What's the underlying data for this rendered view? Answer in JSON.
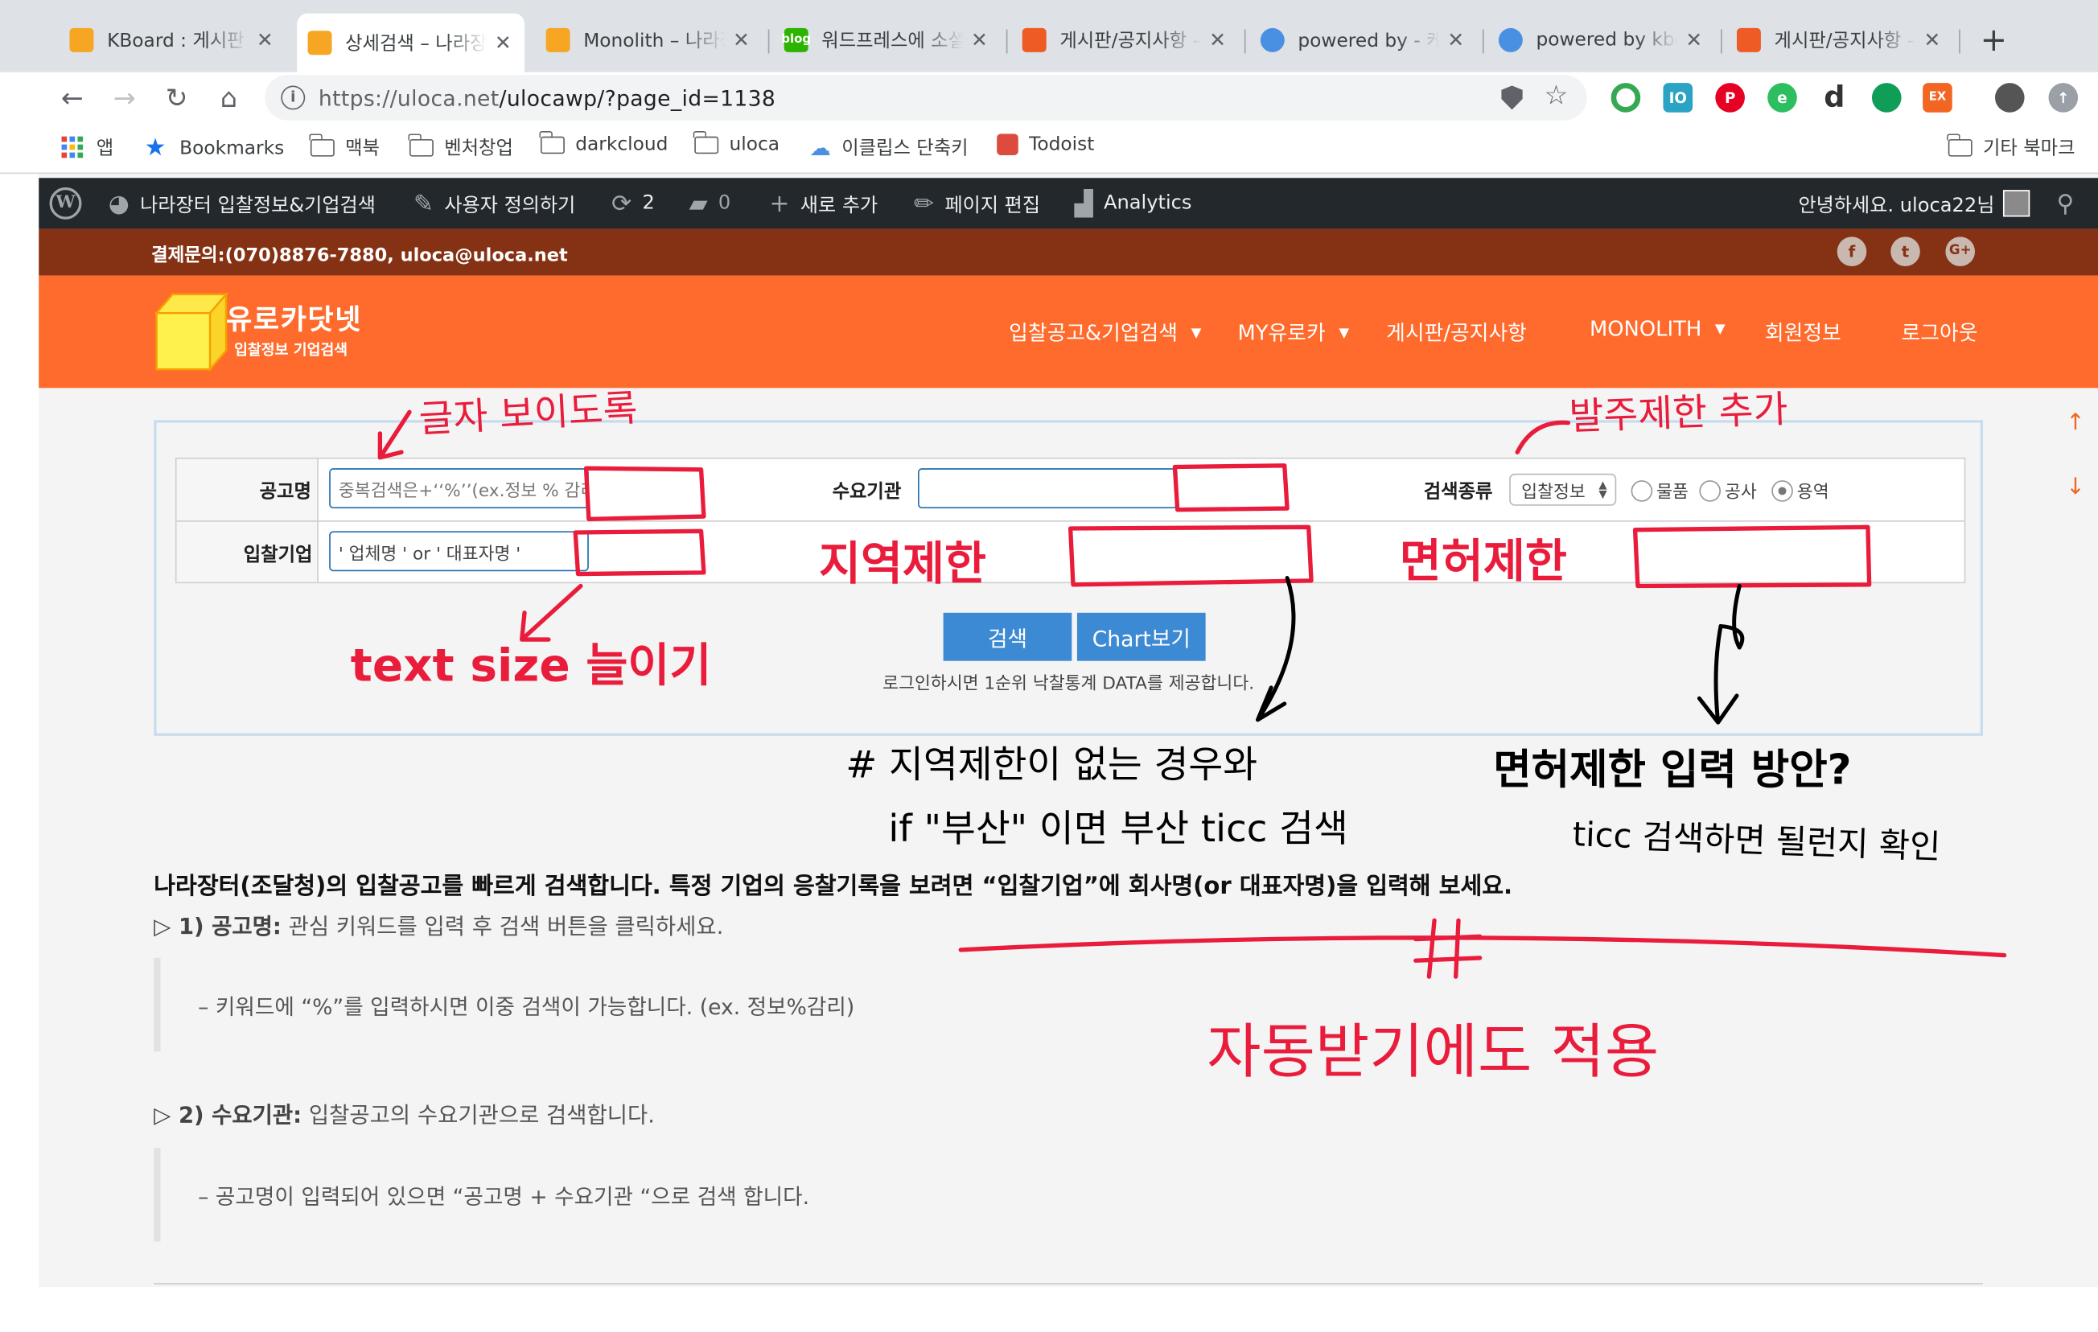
{
  "browser": {
    "tabs": [
      {
        "title": "KBoard : 게시판 플러그인",
        "favicon_color": "#f6a623"
      },
      {
        "title": "상세검색 – 나라장터",
        "favicon_color": "#f6a623"
      },
      {
        "title": "Monolith – 나라장터",
        "favicon_color": "#f6a623"
      },
      {
        "title": "워드프레스에 소셜",
        "favicon_color": "#2db400",
        "favicon_text": "blog"
      },
      {
        "title": "게시판/공지사항 – 유로카",
        "favicon_color": "#ef5b25"
      },
      {
        "title": "powered by - 케이보드",
        "favicon_color": "#4a90e2"
      },
      {
        "title": "powered by kboard",
        "favicon_color": "#4a90e2"
      },
      {
        "title": "게시판/공지사항 – 유로카",
        "favicon_color": "#ef5b25"
      }
    ],
    "url_host": "https://uloca.net",
    "url_path": "/ulocawp/?page_id=1138",
    "bookmarks": {
      "apps": "앱",
      "bookmarks": "Bookmarks",
      "items": [
        "맥북",
        "벤처창업",
        "darkcloud",
        "uloca",
        "이클립스 단축키",
        "Todoist"
      ],
      "other": "기타 북마크"
    }
  },
  "wp_admin_bar": {
    "site": "나라장터 입찰정보&기업검색",
    "customize": "사용자 정의하기",
    "updates": "2",
    "comments": "0",
    "new": "새로 추가",
    "edit": "페이지 편집",
    "analytics": "Analytics",
    "greeting": "안녕하세요. uloca22님"
  },
  "infobar": {
    "contact": "결제문의:(070)8876-7880, uloca@uloca.net"
  },
  "logo": {
    "name": "유로카닷넷",
    "tagline": "입찰정보 기업검색"
  },
  "nav": {
    "items": [
      "입찰공고&기업검색",
      "MY유로카",
      "게시판/공지사항",
      "MONOLITH",
      "회원정보",
      "로그아웃"
    ]
  },
  "search_form": {
    "notice_label": "공고명",
    "notice_placeholder": "중복검색은+‘‘%’’(ex.정보 % 감리)",
    "agency_label": "수요기관",
    "agency_value": "",
    "type_label": "검색종류",
    "type_select": "입찰정보",
    "radio_options": [
      "물품",
      "공사",
      "용역"
    ],
    "radio_selected": "용역",
    "company_label": "입찰기업",
    "company_placeholder": "' 업체명 ' or ' 대표자명 '",
    "search_button": "검색",
    "chart_button": "Chart보기",
    "login_note": "로그인하시면 1순위 낙찰통계 DATA를 제공합니다."
  },
  "content": {
    "intro": "나라장터(조달청)의 입찰공고를 빠르게 검색합니다.  특정 기업의 응찰기록을 보려면 “입찰기업”에 회사명(or 대표자명)을 입력해 보세요.",
    "item1_title": "▷ 1) 공고명:",
    "item1_text": " 관심 키워드를 입력 후 검색 버튼을 클릭하세요.",
    "item1_note": "– 키워드에 “%”를 입력하시면 이중 검색이 가능합니다. (ex. 정보%감리)",
    "item2_title": "▷ 2) 수요기관:",
    "item2_text": " 입찰공고의 수요기관으로 검색합니다.",
    "item2_note": "– 공고명이 입력되어 있으면 “공고명 + 수요기관 “으로 검색 합니다."
  },
  "annotations": {
    "a1": "글자 보이도록",
    "a2": "발주제한 추가",
    "a3": "text size 늘이기",
    "a4": "지역제한",
    "a5": "면허제한",
    "a6": "# 지역제한이 없는 경우와",
    "a7": "if \"부산\" 이면 부산 ticc 검색",
    "a8": "면허제한 입력 방안?",
    "a9": "ticc 검색하면 될런지 확인",
    "a10": "자동받기에도 적용",
    "colors": {
      "red": "#ea1c3c",
      "black": "#000000"
    }
  }
}
